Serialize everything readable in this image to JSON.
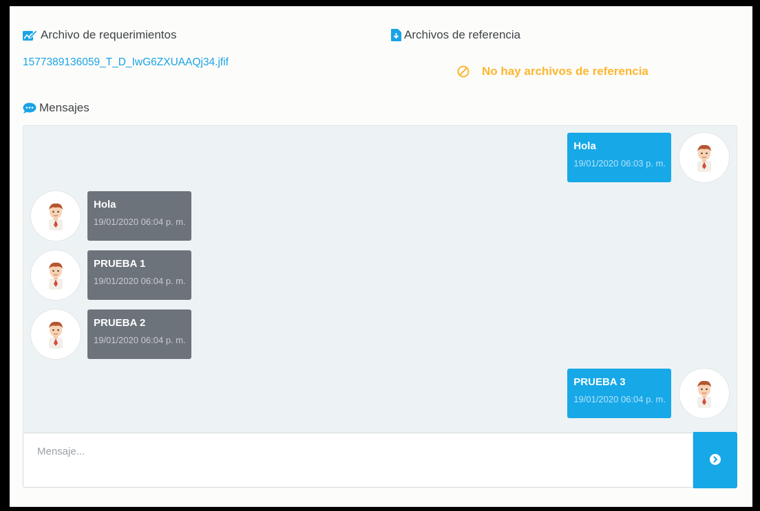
{
  "requirements": {
    "heading": "Archivo de requerimientos",
    "icon": "edit-document-icon",
    "file_name": "1577389136059_T_D_IwG6ZXUAAQj34.jfif"
  },
  "references": {
    "heading": "Archivos de referencia",
    "icon": "file-download-icon",
    "empty_text": "No hay archivos de referencia",
    "empty_icon": "ban-icon"
  },
  "messages_section": {
    "heading": "Mensajes",
    "icon": "chat-bubble-icon"
  },
  "messages": [
    {
      "text": "Hola",
      "time": "19/01/2020 06:03 p. m.",
      "direction": "sent"
    },
    {
      "text": "Hola",
      "time": "19/01/2020 06:04 p. m.",
      "direction": "received"
    },
    {
      "text": "PRUEBA 1",
      "time": "19/01/2020 06:04 p. m.",
      "direction": "received"
    },
    {
      "text": "PRUEBA 2",
      "time": "19/01/2020 06:04 p. m.",
      "direction": "received"
    },
    {
      "text": "PRUEBA 3",
      "time": "19/01/2020 06:04 p. m.",
      "direction": "sent"
    }
  ],
  "composer": {
    "placeholder": "Mensaje...",
    "send_icon": "chevron-circle-right-icon"
  },
  "colors": {
    "accent": "#17a8e8",
    "received_bubble": "#6c737b",
    "warning": "#fdb630",
    "chat_background": "#edf2f4"
  }
}
